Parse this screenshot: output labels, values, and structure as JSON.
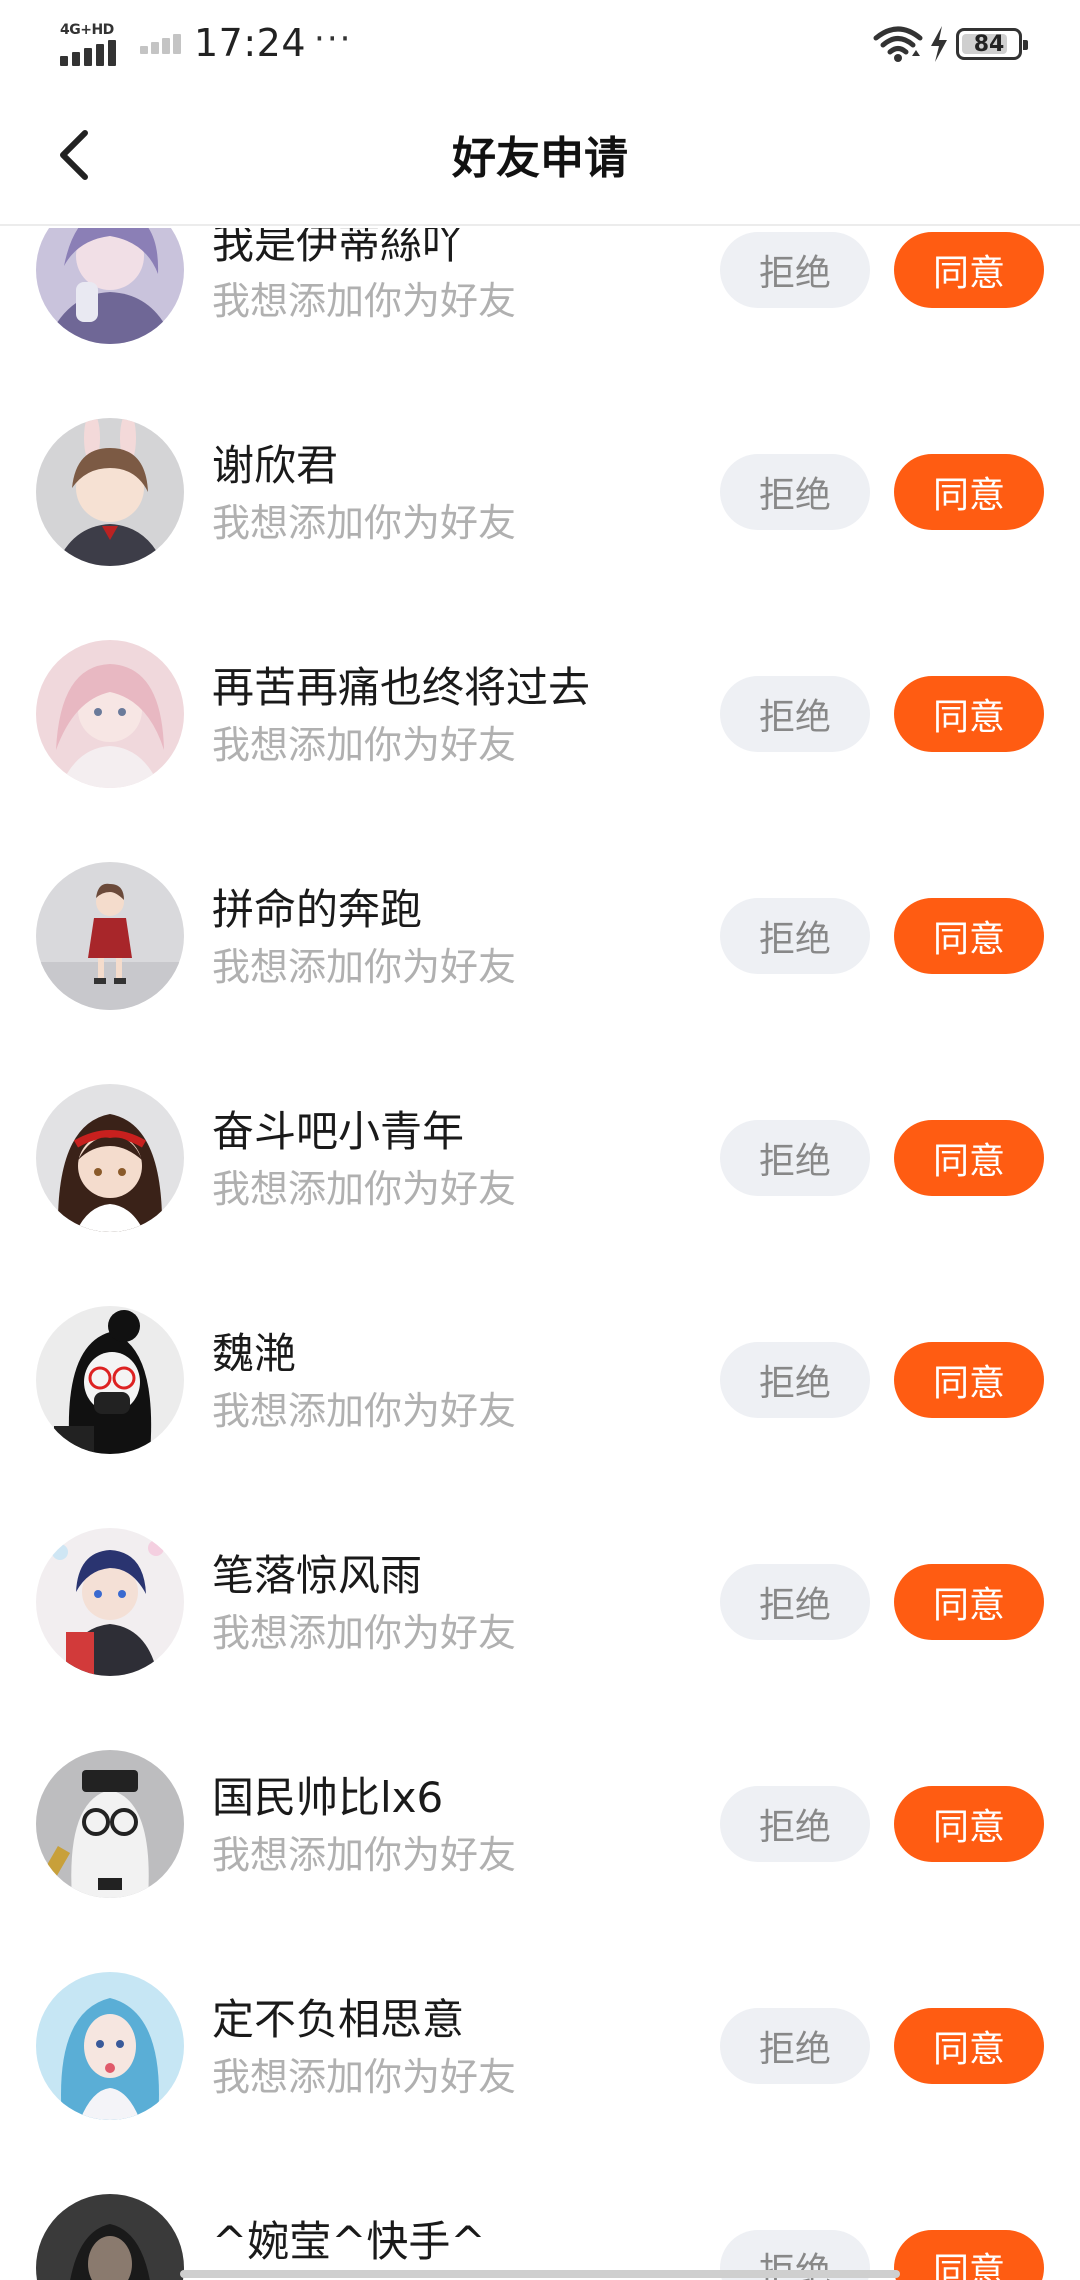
{
  "status_bar": {
    "network": "4G+HD",
    "time": "17:24",
    "more": "···",
    "battery": "84",
    "battery_level": 0.84
  },
  "header": {
    "title": "好友申请",
    "back_icon": "chevron-left-icon"
  },
  "colors": {
    "accent": "#ff5c12",
    "reject_bg": "#eef0f4",
    "reject_text": "#888888",
    "subtitle": "#b0b0b0"
  },
  "requests": [
    {
      "name": "我是伊蒂絲吖",
      "message": "我想添加你为好友",
      "reject": "拒绝",
      "accept": "同意"
    },
    {
      "name": "谢欣君",
      "message": "我想添加你为好友",
      "reject": "拒绝",
      "accept": "同意"
    },
    {
      "name": "再苦再痛也终将过去",
      "message": "我想添加你为好友",
      "reject": "拒绝",
      "accept": "同意"
    },
    {
      "name": "拼命的奔跑",
      "message": "我想添加你为好友",
      "reject": "拒绝",
      "accept": "同意"
    },
    {
      "name": "奋斗吧小青年",
      "message": "我想添加你为好友",
      "reject": "拒绝",
      "accept": "同意"
    },
    {
      "name": "魏滟",
      "message": "我想添加你为好友",
      "reject": "拒绝",
      "accept": "同意"
    },
    {
      "name": "笔落惊风雨",
      "message": "我想添加你为好友",
      "reject": "拒绝",
      "accept": "同意"
    },
    {
      "name": "国民帅比lx6",
      "message": "我想添加你为好友",
      "reject": "拒绝",
      "accept": "同意"
    },
    {
      "name": "定不负相思意",
      "message": "我想添加你为好友",
      "reject": "拒绝",
      "accept": "同意"
    },
    {
      "name": "^婉莹^快手^",
      "message": "",
      "reject": "拒绝",
      "accept": "同意"
    }
  ]
}
